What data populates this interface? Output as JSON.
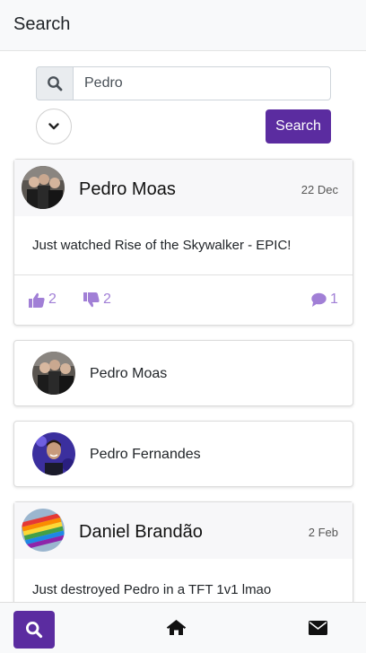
{
  "header": {
    "title": "Search"
  },
  "search": {
    "icon": "search-icon",
    "value": "Pedro",
    "button_label": "Search",
    "toggle_icon": "chevron-down-icon"
  },
  "results": {
    "post1": {
      "author": "Pedro Moas",
      "date": "22 Dec",
      "text": "Just watched Rise of the Skywalker - EPIC!",
      "likes": "2",
      "dislikes": "2",
      "comments": "1"
    },
    "users": [
      {
        "name": "Pedro Moas"
      },
      {
        "name": "Pedro Fernandes"
      }
    ],
    "post2": {
      "author": "Daniel Brandão",
      "date": "2 Feb",
      "text": "Just destroyed Pedro in a TFT 1v1 lmao"
    }
  },
  "bottom_nav": {
    "items": [
      "search-icon",
      "home-icon",
      "envelope-icon"
    ]
  },
  "colors": {
    "accent": "#5b2ca0",
    "accent_light": "#a17fd6",
    "bar_bg": "#f8f9fa"
  }
}
